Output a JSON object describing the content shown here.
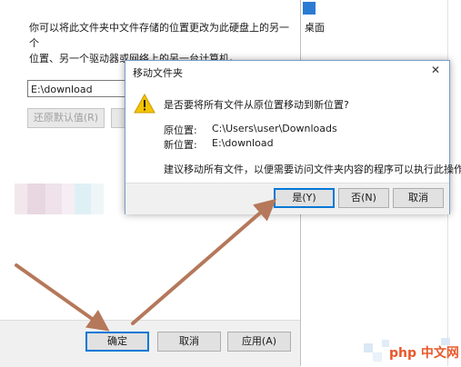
{
  "properties_window": {
    "description_line1": "你可以将此文件夹中文件存储的位置更改为此硬盘上的另一个",
    "description_line2": "位置、另一个驱动器或网络上的另一台计算机。",
    "path_value": "E:\\download",
    "restore_button": "还原默认值(R)",
    "ok_button": "确定",
    "cancel_button": "取消",
    "apply_button": "应用(A)"
  },
  "background_window": {
    "partial_text": "桌面"
  },
  "dialog": {
    "title": "移动文件夹",
    "close_glyph": "✕",
    "question": "是否要将所有文件从原位置移动到新位置?",
    "original_label": "原位置:",
    "original_value": "C:\\Users\\user\\Downloads",
    "new_label": "新位置:",
    "new_value": "E:\\download",
    "note": "建议移动所有文件，以便需要访问文件夹内容的程序可以执行此操作。",
    "yes_button": "是(Y)",
    "no_button": "否(N)",
    "cancel_button": "取消"
  },
  "watermark": {
    "text": "php 中文网"
  },
  "colors": {
    "arrow": "#b5785a",
    "warning": "#f5c400",
    "accent": "#0078d7"
  }
}
